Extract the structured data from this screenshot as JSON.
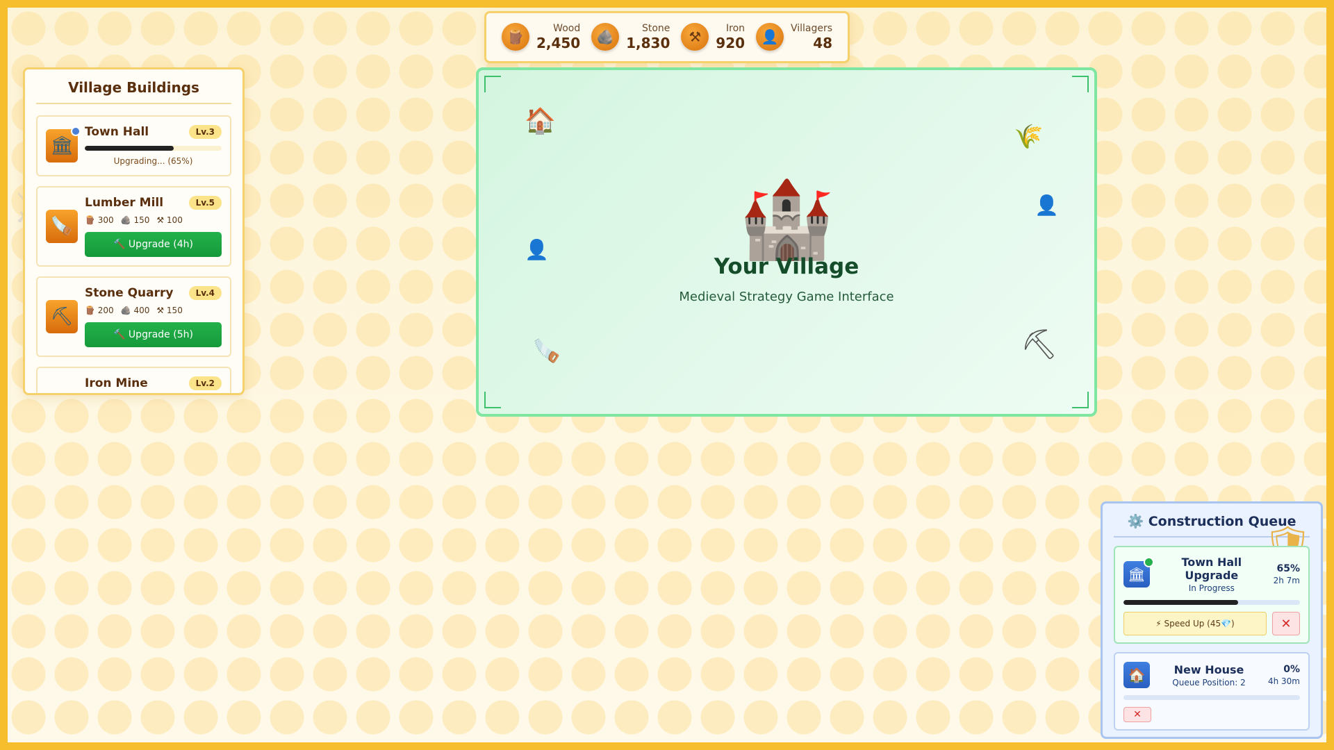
{
  "resources": [
    {
      "label": "Wood",
      "value": "2,450",
      "icon": "log-icon",
      "glyph": "🪵"
    },
    {
      "label": "Stone",
      "value": "1,830",
      "icon": "rock-icon",
      "glyph": "🪨"
    },
    {
      "label": "Iron",
      "value": "920",
      "icon": "hammer-pick-icon",
      "glyph": "⚒"
    },
    {
      "label": "Villagers",
      "value": "48",
      "icon": "person-icon",
      "glyph": "👤"
    }
  ],
  "buildings_panel": {
    "title": "Village Buildings",
    "items": [
      {
        "name": "Town Hall",
        "level": "Lv.3",
        "status": "Upgrading... (65%)",
        "progress": 0.65,
        "glyph": "🏛"
      },
      {
        "name": "Lumber Mill",
        "level": "Lv.5",
        "cost_wood": "300",
        "cost_stone": "150",
        "cost_iron": "100",
        "button": "🔨 Upgrade (4h)",
        "glyph": "🪚"
      },
      {
        "name": "Stone Quarry",
        "level": "Lv.4",
        "cost_wood": "200",
        "cost_stone": "400",
        "cost_iron": "150",
        "button": "🔨 Upgrade (5h)",
        "glyph": "⛏"
      },
      {
        "name": "Iron Mine",
        "level": "Lv.2"
      }
    ]
  },
  "village": {
    "title": "Your Village",
    "subtitle": "Medieval Strategy Game Interface",
    "castle_glyph": "🏰",
    "house_glyph": "🏠",
    "wheat_glyph": "🌾",
    "person_glyph": "👤",
    "saw_glyph": "🪚",
    "pick_glyph": "⛏"
  },
  "queue": {
    "title": "⚙️ Construction Queue",
    "items": [
      {
        "name": "Town Hall Upgrade",
        "state": "In Progress",
        "percent": "65%",
        "time": "2h 7m",
        "progress": 0.65,
        "speed_label": "⚡ Speed Up (45💎)",
        "cancel_label": "✕",
        "glyph": "🏛"
      },
      {
        "name": "New House",
        "state": "Queue Position: 2",
        "percent": "0%",
        "time": "4h 30m",
        "progress": 0,
        "cancel_label": "✕",
        "glyph": "🏠"
      }
    ]
  },
  "colors": {
    "accent": "#f6be2c",
    "upgrade": "#1aa544",
    "queue_border": "#a8c4f2"
  }
}
